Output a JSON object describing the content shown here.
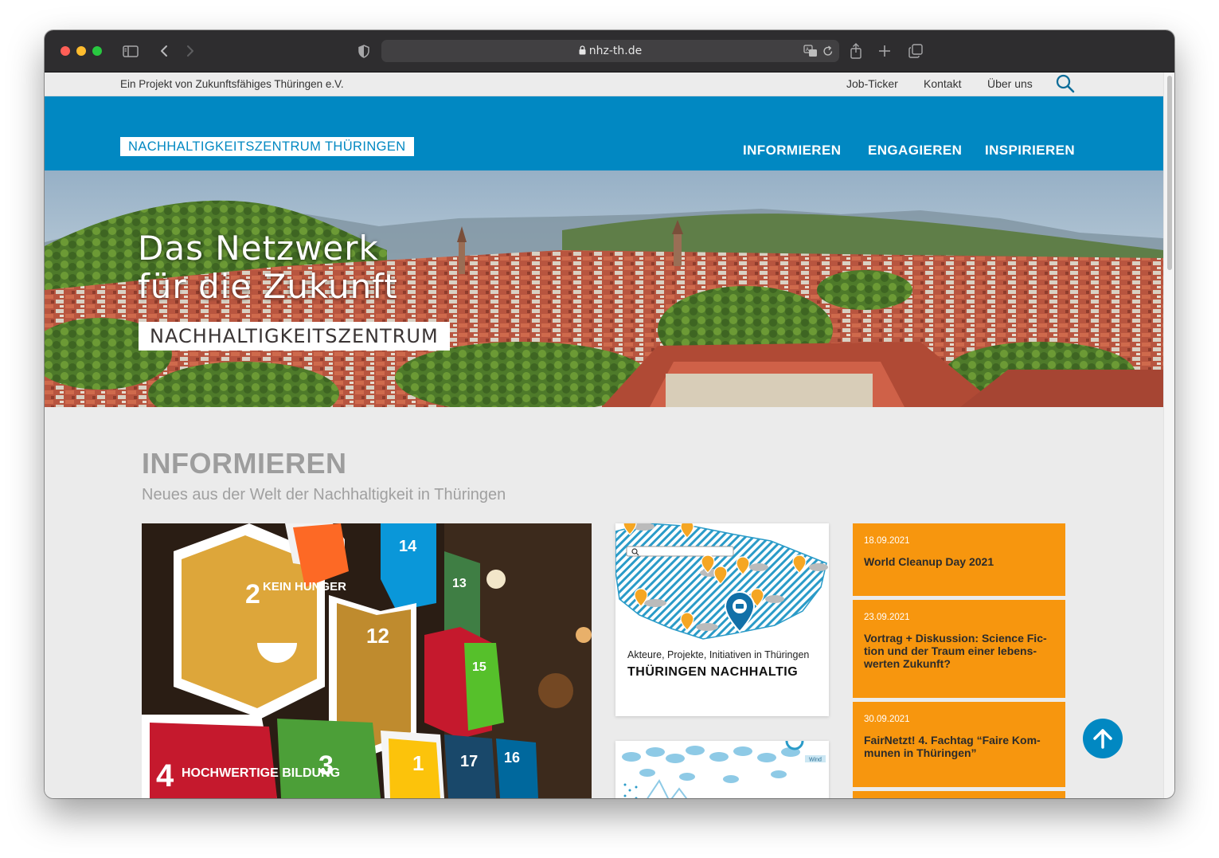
{
  "browser": {
    "url": "nhz-th.de"
  },
  "topbar": {
    "project_text": "Ein Projekt von Zukunftsfähiges Thüringen e.V.",
    "links": [
      "Job-Ticker",
      "Kontakt",
      "Über uns"
    ]
  },
  "header": {
    "logo": "NACHHALTIGKEITSZENTRUM THÜRINGEN",
    "nav": [
      "INFORMIEREN",
      "ENGAGIEREN",
      "INSPIRIEREN"
    ]
  },
  "hero": {
    "line1": "Das Netzwerk",
    "line2": "für die Zukunft",
    "badge": "NACHHALTIGKEITSZENTRUM"
  },
  "section": {
    "title": "INFORMIEREN",
    "subtitle": "Neues aus der Welt der Nachhaltigkeit in Thüringen"
  },
  "photo": {
    "box_numbers": [
      "2",
      "12",
      "4",
      "3",
      "1",
      "17",
      "16",
      "14",
      "13",
      "15"
    ],
    "box_labels": [
      "KEIN HUNGER",
      "HOCHWERTIGE BILDUNG"
    ]
  },
  "cards": [
    {
      "subtitle": "Akteure, Projekte, Initiativen in Thüringen",
      "title": "THÜRINGEN NACHHALTIG"
    },
    {
      "badge": "Wind"
    }
  ],
  "events": [
    {
      "date": "18.09.2021",
      "title": "World Cleanup Day 2021"
    },
    {
      "date": "23.09.2021",
      "title": "Vortrag + Diskussion: Science Fic­tion und der Traum einer lebens­werten Zukunft?"
    },
    {
      "date": "30.09.2021",
      "title": "FairNetzt! 4. Fachtag “Faire Kom­munen in Thüringen”"
    }
  ],
  "colors": {
    "brand_blue": "#0188c2",
    "event_orange": "#f7960e",
    "page_bg": "#ebebeb",
    "section_gray": "#9d9d9d"
  },
  "icons": [
    "sidebar-icon",
    "back-icon",
    "forward-icon",
    "shield-icon",
    "lock-icon",
    "translate-icon",
    "reload-icon",
    "share-icon",
    "new-tab-icon",
    "tabs-icon",
    "search-icon",
    "arrow-up-icon",
    "map-pin-icon"
  ]
}
